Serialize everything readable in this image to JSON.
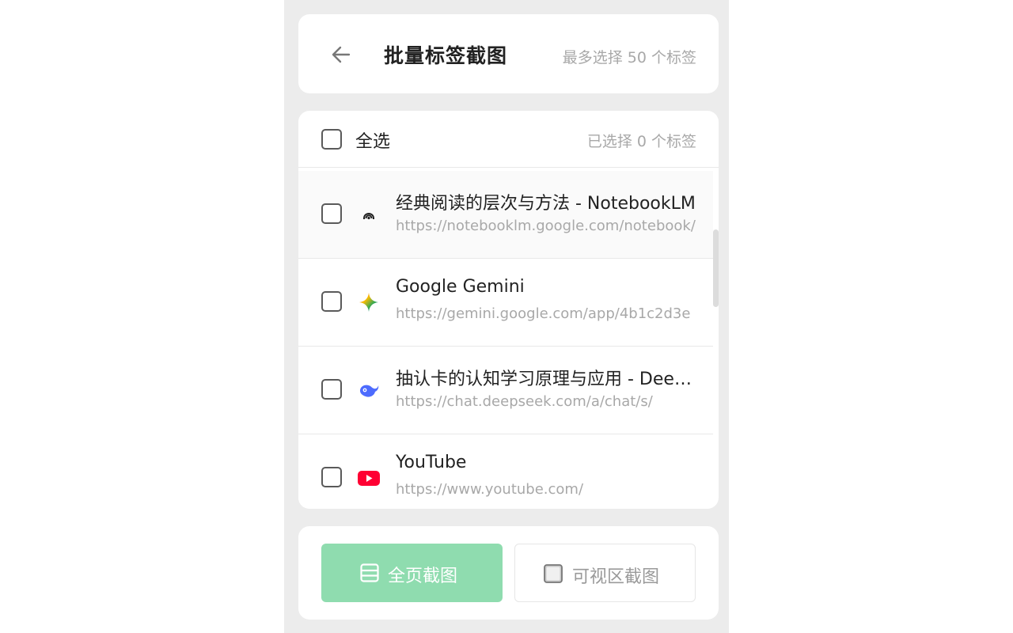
{
  "header": {
    "back_icon": "arrow-left-icon",
    "title": "批量标签截图",
    "limit_hint": "最多选择 50 个标签"
  },
  "list": {
    "select_all_label": "全选",
    "selected_count": "已选择 0 个标签",
    "tabs": [
      {
        "title": "经典阅读的层次与方法 - NotebookLM",
        "url": "https://notebooklm.google.com/notebook/",
        "favicon": "notebooklm-icon",
        "checked": false
      },
      {
        "title": "Google Gemini",
        "url": "https://gemini.google.com/app/4b1c2d3e",
        "favicon": "gemini-icon",
        "checked": false
      },
      {
        "title": "抽认卡的认知学习原理与应用 - DeepSeek",
        "url": "https://chat.deepseek.com/a/chat/s/",
        "favicon": "deepseek-icon",
        "checked": false
      },
      {
        "title": "YouTube",
        "url": "https://www.youtube.com/",
        "favicon": "youtube-icon",
        "checked": false
      }
    ]
  },
  "footer": {
    "full_page_label": "全页截图",
    "full_page_icon": "full-page-icon",
    "visible_area_label": "可视区截图",
    "visible_area_icon": "visible-area-icon"
  },
  "colors": {
    "panel_bg": "#ececec",
    "primary_button": "#8fdcaf",
    "muted_text": "#a8a8a8"
  }
}
